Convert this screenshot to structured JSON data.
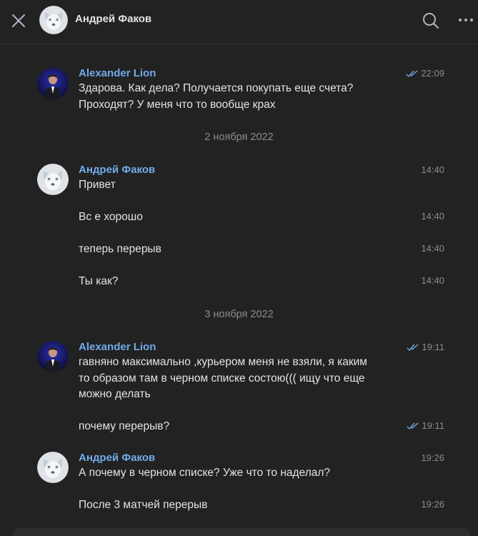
{
  "header": {
    "title": "Андрей Факов"
  },
  "dates": {
    "d1": "2 ноября 2022",
    "d2": "3 ноября 2022"
  },
  "messages": [
    {
      "author": "Alexander Lion",
      "time": "22:09",
      "lines": [
        "Здарова. Как дела? Получается покупать еще счета?",
        "Проходят? У меня что то вообще крах"
      ]
    },
    {
      "author": "Андрей Факов",
      "time": "14:40",
      "lines": [
        "Привет"
      ]
    },
    {
      "time": "14:40",
      "lines": [
        "Вс е хорошо"
      ]
    },
    {
      "time": "14:40",
      "lines": [
        "теперь перерыв"
      ]
    },
    {
      "time": "14:40",
      "lines": [
        "Ты как?"
      ]
    },
    {
      "author": "Alexander Lion",
      "time": "19:11",
      "lines": [
        "гавняно максимально ,курьером меня не взяли, я каким",
        "то образом там в черном списке состою((( ищу что еще",
        "можно делать"
      ]
    },
    {
      "time": "19:11",
      "lines": [
        "почему перерыв?"
      ]
    },
    {
      "author": "Андрей Факов",
      "time": "19:26",
      "lines": [
        "А почему в черном списке? Уже что то наделал?"
      ]
    },
    {
      "time": "19:26",
      "lines": [
        "После 3 матчей перерыв"
      ]
    }
  ],
  "colors": {
    "background": "#222222",
    "author": "#71aaeb",
    "text": "#e1e3e6",
    "muted": "#8a8c8f",
    "read_check": "#71aaeb"
  }
}
